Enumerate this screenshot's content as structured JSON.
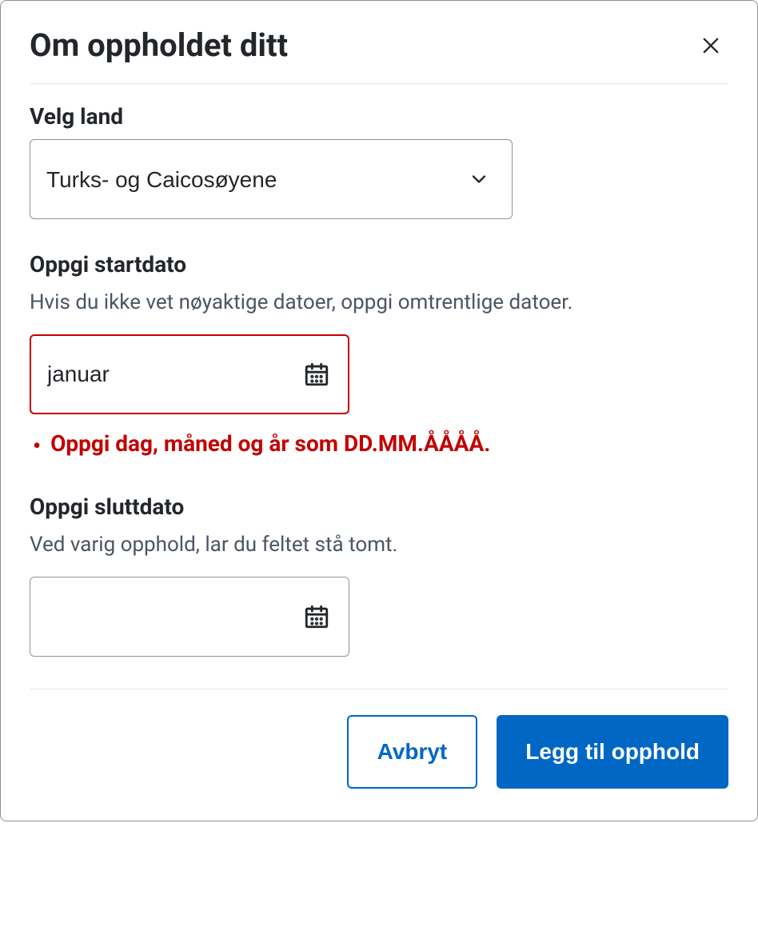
{
  "dialog": {
    "title": "Om oppholdet ditt"
  },
  "country": {
    "label": "Velg land",
    "value": "Turks- og Caicosøyene"
  },
  "startDate": {
    "label": "Oppgi startdato",
    "hint": "Hvis du ikke vet nøyaktige datoer, oppgi omtrentlige datoer.",
    "value": "januar",
    "error": "Oppgi dag, måned og år som DD.MM.ÅÅÅÅ."
  },
  "endDate": {
    "label": "Oppgi sluttdato",
    "hint": "Ved varig opphold, lar du feltet stå tomt.",
    "value": ""
  },
  "actions": {
    "cancel": "Avbryt",
    "submit": "Legg til opphold"
  }
}
